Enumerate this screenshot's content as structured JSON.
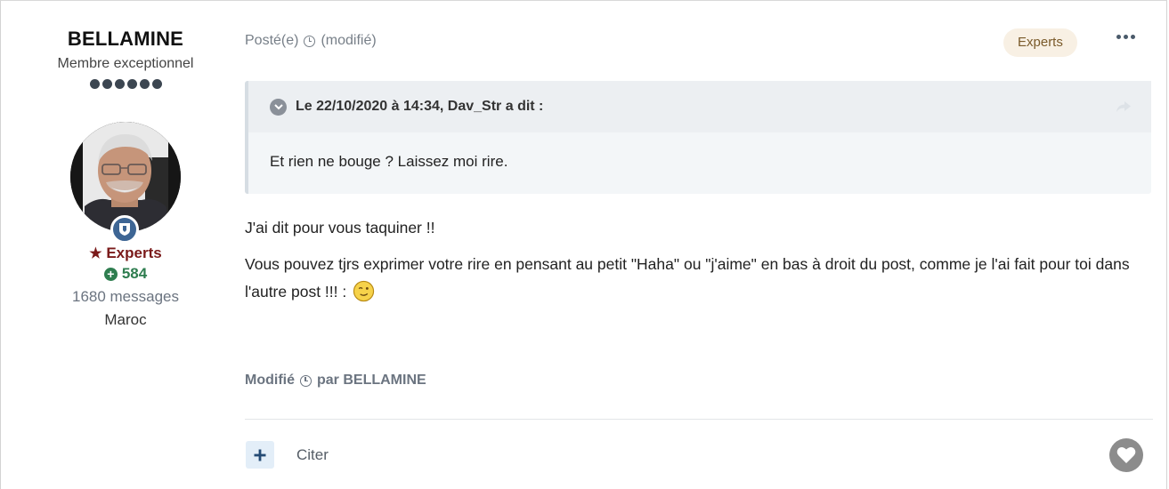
{
  "author": {
    "name": "BELLAMINE",
    "title": "Membre exceptionnel",
    "group": "Experts",
    "reputation": "584",
    "post_count": "1680 messages",
    "location": "Maroc",
    "rank_dots": 6
  },
  "post": {
    "posted_label": "Posté(e)",
    "modified_label": "(modifié)",
    "group_badge": "Experts",
    "quote": {
      "citation": "Le 22/10/2020 à 14:34, Dav_Str a dit :",
      "text": "Et rien ne bouge ? Laissez moi rire."
    },
    "paragraphs": [
      "J'ai dit pour vous taquiner !!",
      "Vous pouvez tjrs exprimer votre rire en pensant au petit \"Haha\" ou \"j'aime\" en bas à droit du post, comme je l'ai fait pour toi dans l'autre post !!! :"
    ],
    "edited_label": "Modifié",
    "edited_by": "par BELLAMINE"
  },
  "actions": {
    "multiquote_label": "+",
    "quote_label": "Citer"
  },
  "icons": {
    "clock": "clock-icon",
    "more": "ellipsis-icon",
    "toggle": "chevron-down-icon",
    "share": "share-arrow-icon",
    "reaction": "heart-icon",
    "emoji": "wink-emoji"
  },
  "colors": {
    "group_color": "#7a1a1a",
    "reputation_color": "#2e7d4f",
    "badge_bg": "#3d6594",
    "pill_bg": "#f8f0e4"
  }
}
